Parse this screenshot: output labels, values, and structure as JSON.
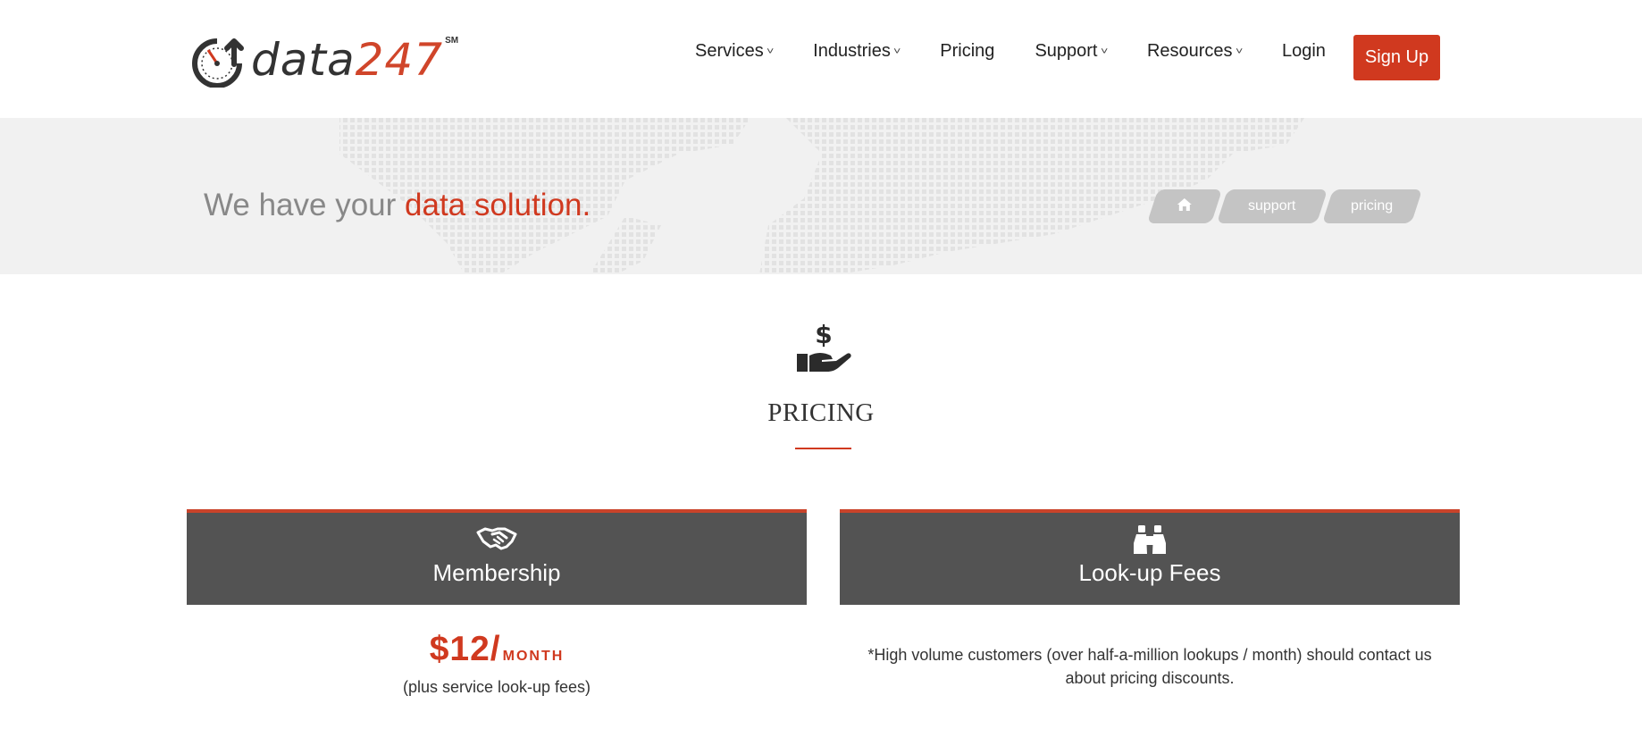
{
  "header": {
    "logo": {
      "word": "data",
      "number": "247",
      "mark": "SM"
    },
    "nav": [
      {
        "label": "Services",
        "has_dropdown": true
      },
      {
        "label": "Industries",
        "has_dropdown": true
      },
      {
        "label": "Pricing",
        "has_dropdown": false
      },
      {
        "label": "Support",
        "has_dropdown": true
      },
      {
        "label": "Resources",
        "has_dropdown": true
      },
      {
        "label": "Login",
        "has_dropdown": false
      }
    ],
    "signup_label": "Sign Up"
  },
  "banner": {
    "tagline_prefix": "We have your ",
    "tagline_accent": "data solution.",
    "breadcrumbs": [
      {
        "label": "",
        "icon": "home-icon"
      },
      {
        "label": "support"
      },
      {
        "label": "pricing"
      }
    ]
  },
  "section": {
    "icon": "hand-dollar-icon",
    "title": "PRICING"
  },
  "cards": {
    "membership": {
      "icon": "handshake-icon",
      "title": "Membership",
      "price_amount": "$12/",
      "price_period": "MONTH",
      "note": "(plus service look-up fees)"
    },
    "lookup": {
      "icon": "binoculars-icon",
      "title": "Look-up Fees",
      "note": "*High volume customers (over half-a-million lookups / month) should contact us about pricing discounts."
    }
  },
  "colors": {
    "accent": "#d0391f",
    "card_header": "#535353",
    "banner_bg": "#f1f1f1",
    "crumb_bg": "#c4c4c4"
  }
}
